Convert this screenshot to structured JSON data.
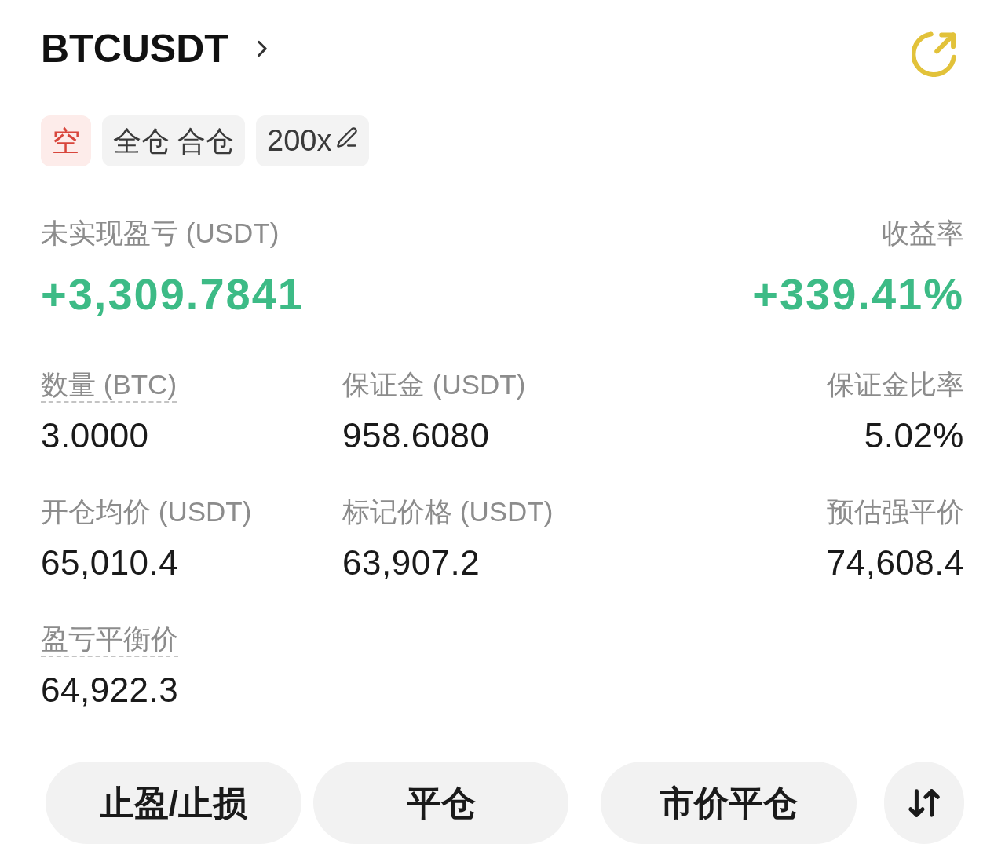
{
  "header": {
    "symbol": "BTCUSDT"
  },
  "tags": [
    {
      "label": "空",
      "kind": "side"
    },
    {
      "label": "全仓 合仓",
      "kind": "mode"
    },
    {
      "label": "200x",
      "kind": "leverage"
    }
  ],
  "pnl": {
    "label": "未实现盈亏 (USDT)",
    "value": "+3,309.7841"
  },
  "roe": {
    "label": "收益率",
    "value": "+339.41%"
  },
  "fields": [
    {
      "label": "数量 (BTC)",
      "value": "3.0000",
      "dashed_underline": true
    },
    {
      "label": "保证金 (USDT)",
      "value": "958.6080",
      "dashed_underline": false
    },
    {
      "label": "保证金比率",
      "value": "5.02%",
      "dashed_underline": false
    },
    {
      "label": "开仓均价 (USDT)",
      "value": "65,010.4",
      "dashed_underline": false
    },
    {
      "label": "标记价格 (USDT)",
      "value": "63,907.2",
      "dashed_underline": false
    },
    {
      "label": "预估强平价",
      "value": "74,608.4",
      "dashed_underline": false
    },
    {
      "label": "盈亏平衡价",
      "value": "64,922.3",
      "dashed_underline": true
    }
  ],
  "actions": [
    {
      "label": "止盈/止损"
    },
    {
      "label": "平仓"
    },
    {
      "label": "市价平仓"
    }
  ]
}
